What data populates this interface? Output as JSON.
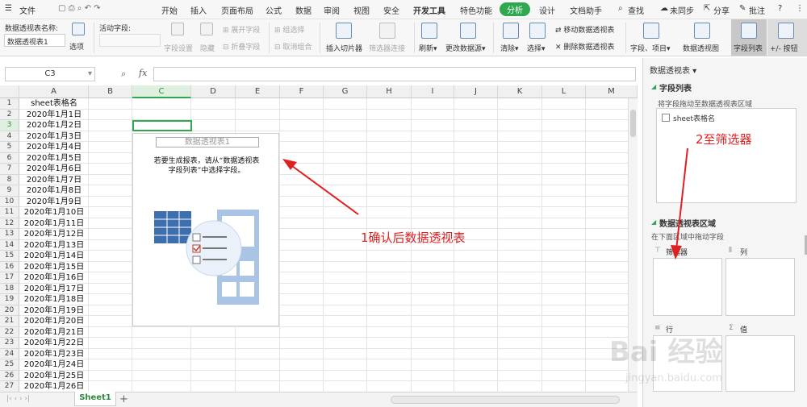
{
  "menubar": {
    "items": [
      "文件",
      "开始",
      "插入",
      "页面布局",
      "公式",
      "数据",
      "审阅",
      "视图",
      "安全",
      "开发工具",
      "特色功能",
      "分析",
      "设计",
      "文档助手"
    ],
    "active": "分析",
    "search": "查找",
    "sync": "未同步",
    "share": "分享",
    "comment": "批注",
    "help": "?"
  },
  "ribbon": {
    "pt_name_label": "数据透视表名称:",
    "pt_name_value": "数据透视表1",
    "options": "选项",
    "active_field_label": "活动字段:",
    "field_settings": "字段设置",
    "hide": "隐藏",
    "expand_field": "展开字段",
    "collapse_field": "折叠字段",
    "group_select": "组选择",
    "ungroup": "取消组合",
    "insert_slicer": "插入切片器",
    "filter_conn": "筛选器连接",
    "refresh": "刷新",
    "change_source": "更改数据源",
    "clear": "清除",
    "select": "选择",
    "move_pt": "移动数据透视表",
    "delete_pt": "删除数据透视表",
    "fields_items": "字段、项目",
    "pivot_chart": "数据透视图",
    "field_list": "字段列表",
    "buttons": "+/- 按钮"
  },
  "formula_bar": {
    "name_box": "C3",
    "fx": "fx",
    "value": ""
  },
  "grid": {
    "columns": [
      "A",
      "B",
      "C",
      "D",
      "E",
      "F",
      "G",
      "H",
      "I",
      "J",
      "K",
      "L",
      "M"
    ],
    "rows": [
      "1",
      "2",
      "3",
      "4",
      "5",
      "6",
      "7",
      "8",
      "9",
      "10",
      "11",
      "12",
      "13",
      "14",
      "15",
      "16",
      "17",
      "18",
      "19",
      "20",
      "21",
      "22",
      "23",
      "24",
      "25",
      "26",
      "27"
    ],
    "colA": [
      "sheet表格名",
      "2020年1月1日",
      "2020年1月2日",
      "2020年1月3日",
      "2020年1月4日",
      "2020年1月5日",
      "2020年1月6日",
      "2020年1月7日",
      "2020年1月8日",
      "2020年1月9日",
      "2020年1月10日",
      "2020年1月11日",
      "2020年1月12日",
      "2020年1月13日",
      "2020年1月14日",
      "2020年1月15日",
      "2020年1月16日",
      "2020年1月17日",
      "2020年1月18日",
      "2020年1月19日",
      "2020年1月20日",
      "2020年1月21日",
      "2020年1月22日",
      "2020年1月23日",
      "2020年1月24日",
      "2020年1月25日",
      "2020年1月26日"
    ]
  },
  "pivot_placeholder": {
    "title": "数据透视表1",
    "line1": "若要生成报表，请从“数据透视表",
    "line2": "字段列表”中选择字段。"
  },
  "annotations": {
    "a1": "1确认后数据透视表",
    "a2": "2至筛选器",
    "color": "#e02020"
  },
  "sheet_tabs": {
    "active": "Sheet1",
    "add": "+"
  },
  "panel": {
    "title": "数据透视表",
    "field_list_header": "字段列表",
    "field_list_hint": "将字段拖动至数据透视表区域",
    "field_item": "sheet表格名",
    "area_header": "数据透视表区域",
    "area_hint": "在下面区域中拖动字段",
    "filter_label": "筛选器",
    "column_label": "列",
    "row_label": "行",
    "value_label": "值"
  },
  "watermark": {
    "brand": "Bai 经验",
    "url": "jingyan.baidu.com"
  }
}
